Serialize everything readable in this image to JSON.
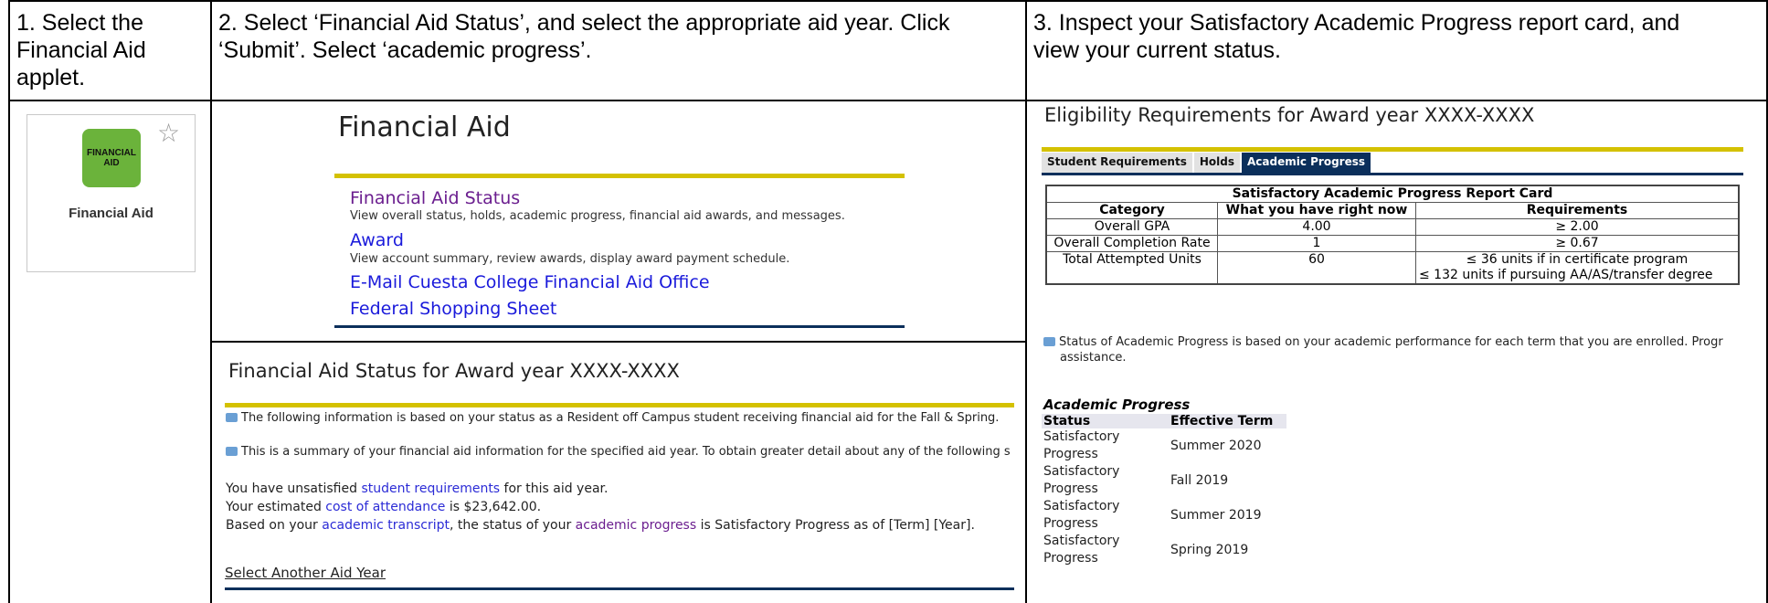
{
  "steps": [
    {
      "lines": [
        "1. Select the",
        "Financial Aid",
        "applet."
      ]
    },
    {
      "lines": [
        "2. Select ‘Financial Aid Status’, and select the appropriate aid year. Click",
        "‘Submit’. Select ‘academic progress’."
      ]
    },
    {
      "lines": [
        "3. Inspect your Satisfactory Academic Progress report card, and",
        "view your current status."
      ]
    }
  ],
  "applet": {
    "logo_line1": "FINANCIAL",
    "logo_line2": "AID",
    "name": "Financial Aid",
    "logo_color": "#6bb33b",
    "star_icon": "star-outline-icon"
  },
  "fa_menu": {
    "title": "Financial Aid",
    "items": [
      {
        "label": "Financial Aid Status",
        "desc": "View overall status, holds, academic progress, financial aid awards, and messages."
      },
      {
        "label": "Award",
        "desc": "View account summary, review awards, display award payment schedule."
      },
      {
        "label": "E-Mail Cuesta College Financial Aid Office",
        "desc": ""
      },
      {
        "label": "Federal Shopping Sheet",
        "desc": ""
      }
    ]
  },
  "fa_status": {
    "title": "Financial Aid Status for Award year XXXX-XXXX",
    "note1": "The following information is based on your status as a Resident off Campus student receiving financial aid for the Fall & Spring.",
    "note2": "This is a summary of your financial aid information for the specified aid year. To obtain greater detail about any of the following s",
    "line1_pre": "You have unsatisfied ",
    "line1_link": "student requirements",
    "line1_post": " for this aid year.",
    "line2_pre": "Your estimated ",
    "line2_link": "cost of attendance",
    "line2_post": " is $23,642.00.",
    "line3_pre": "Based on your ",
    "line3_link1": "academic transcript",
    "line3_mid": ", the status of your ",
    "line3_link2": "academic progress",
    "line3_post": " is Satisfactory Progress as of [Term] [Year].",
    "select_another": "Select Another Aid Year"
  },
  "eligibility": {
    "title": "Eligibility Requirements for Award year XXXX-XXXX",
    "tabs": [
      "Student Requirements",
      "Holds",
      "Academic Progress"
    ],
    "active_tab": 2,
    "report_card": {
      "caption": "Satisfactory Academic Progress Report Card",
      "headers": [
        "Category",
        "What you have right now",
        "Requirements"
      ],
      "rows": [
        {
          "category": "Overall GPA",
          "current": "4.00",
          "req": "≥ 2.00",
          "req2": ""
        },
        {
          "category": "Overall Completion Rate",
          "current": "1",
          "req": "≥ 0.67",
          "req2": ""
        },
        {
          "category": "Total Attempted Units",
          "current": "60",
          "req": "≤ 36 units if in certificate program",
          "req2": "≤ 132 units if pursuing AA/AS/transfer degree"
        }
      ]
    },
    "status_note_line1": "Status of Academic Progress is based on your academic performance for each term that you are enrolled. Progr",
    "status_note_line2": "assistance.",
    "academic_progress": {
      "title": "Academic Progress",
      "headers": [
        "Status",
        "Effective Term"
      ],
      "rows": [
        [
          "Satisfactory Progress",
          "Summer 2020"
        ],
        [
          "Satisfactory Progress",
          "Fall 2019"
        ],
        [
          "Satisfactory Progress",
          "Summer 2019"
        ],
        [
          "Satisfactory Progress",
          "Spring 2019"
        ]
      ]
    }
  }
}
